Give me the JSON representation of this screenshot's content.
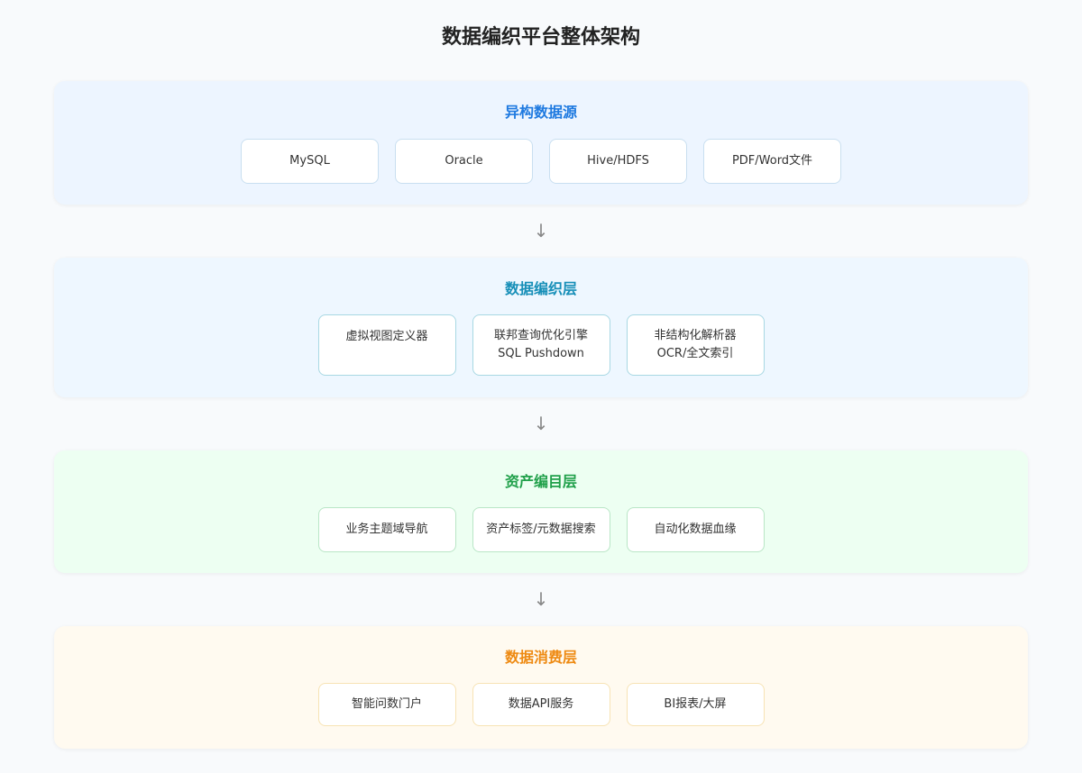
{
  "title": "数据编织平台整体架构",
  "arrow_glyph": "↓",
  "layers": [
    {
      "title": "异构数据源",
      "color": "#1f7ae0",
      "items": [
        {
          "lines": [
            "MySQL"
          ]
        },
        {
          "lines": [
            "Oracle"
          ]
        },
        {
          "lines": [
            "Hive/HDFS"
          ]
        },
        {
          "lines": [
            "PDF/Word文件"
          ]
        }
      ]
    },
    {
      "title": "数据编织层",
      "color": "#178fb8",
      "items": [
        {
          "lines": [
            "虚拟视图定义器"
          ]
        },
        {
          "lines": [
            "联邦查询优化引擎",
            "SQL Pushdown"
          ]
        },
        {
          "lines": [
            "非结构化解析器",
            "OCR/全文索引"
          ]
        }
      ]
    },
    {
      "title": "资产编目层",
      "color": "#20a04a",
      "items": [
        {
          "lines": [
            "业务主题域导航"
          ]
        },
        {
          "lines": [
            "资产标签/元数据搜索"
          ]
        },
        {
          "lines": [
            "自动化数据血缘"
          ]
        }
      ]
    },
    {
      "title": "数据消费层",
      "color": "#ee8a12",
      "items": [
        {
          "lines": [
            "智能问数门户"
          ]
        },
        {
          "lines": [
            "数据API服务"
          ]
        },
        {
          "lines": [
            "BI报表/大屏"
          ]
        }
      ]
    }
  ]
}
